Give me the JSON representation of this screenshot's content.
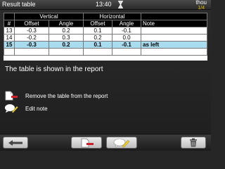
{
  "header": {
    "title": "Result table",
    "time": "13:40",
    "unit": "thou",
    "unit_sub": "1/4"
  },
  "table": {
    "group_headers": {
      "vertical": "Vertical",
      "horizontal": "Horizontal"
    },
    "columns": [
      "#",
      "Offset",
      "Angle",
      "Offset",
      "Angle",
      "Note"
    ],
    "rows": [
      {
        "num": "13",
        "v_offset": "-0.3",
        "v_angle": "0.2",
        "h_offset": "0.1",
        "h_angle": "-0.1",
        "note": ""
      },
      {
        "num": "14",
        "v_offset": "-0.2",
        "v_angle": "0.3",
        "h_offset": "0.2",
        "h_angle": "0.0",
        "note": ""
      },
      {
        "num": "15",
        "v_offset": "-0.3",
        "v_angle": "0.2",
        "h_offset": "0.1",
        "h_angle": "-0.1",
        "note": "as left",
        "selected": true
      }
    ]
  },
  "message": "The table is shown in the report",
  "actions": {
    "remove_label": "Remove the table from the report",
    "edit_label": "Edit note"
  },
  "icons": {
    "hourglass": "hourglass-icon",
    "remove": "remove-from-report-icon",
    "edit": "edit-note-icon",
    "back": "back-arrow-icon",
    "trash": "trash-icon"
  },
  "colors": {
    "selected_row": "#a9dcef",
    "accent_yellow": "#e6c200",
    "remove_red": "#d0202a"
  }
}
